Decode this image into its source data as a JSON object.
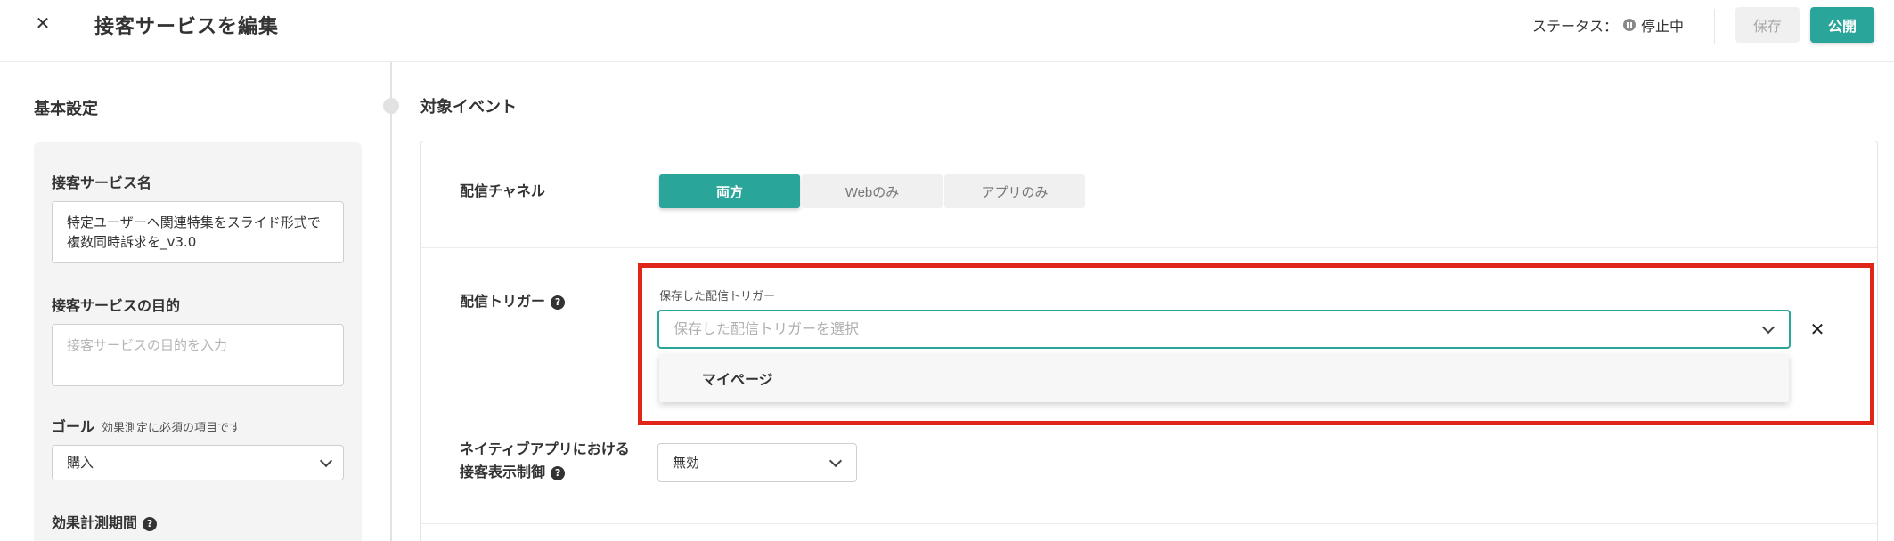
{
  "header": {
    "title": "接客サービスを編集",
    "status_label": "ステータス：",
    "status_value": "停止中",
    "save_label": "保存",
    "publish_label": "公開"
  },
  "basic": {
    "title": "基本設定",
    "name_label": "接客サービス名",
    "name_value": "特定ユーザーへ関連特集をスライド形式で複数同時訴求を_v3.0",
    "purpose_label": "接客サービスの目的",
    "purpose_placeholder": "接客サービスの目的を入力",
    "goal_label": "ゴール",
    "goal_note": "効果測定に必須の項目です",
    "goal_value": "購入",
    "period_label": "効果計測期間"
  },
  "event": {
    "title": "対象イベント",
    "channel_label": "配信チャネル",
    "channels": [
      "両方",
      "Webのみ",
      "アプリのみ"
    ],
    "trigger_label": "配信トリガー",
    "trigger_caption": "保存した配信トリガー",
    "trigger_placeholder": "保存した配信トリガーを選択",
    "dropdown_options": [
      "マイページ"
    ],
    "native_label_line1": "ネイティブアプリにおける",
    "native_label_line2": "接客表示制御",
    "native_value": "無効"
  },
  "colors": {
    "accent": "#2aa59a",
    "highlight": "#e0261a"
  }
}
